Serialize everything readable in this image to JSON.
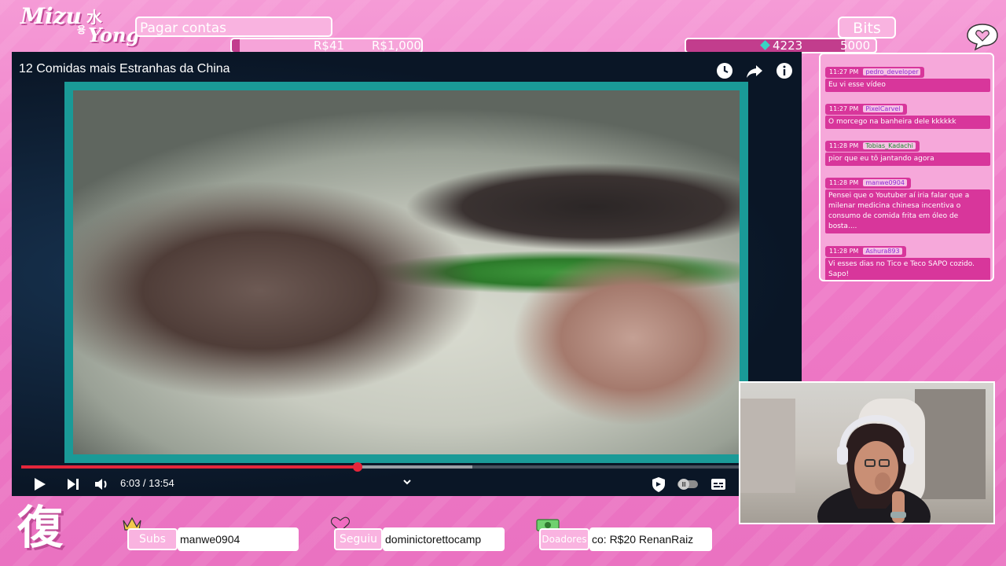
{
  "overlay": {
    "logo": {
      "name": "Mizu",
      "kanji": "水",
      "hangul": "용",
      "name2": "Yong"
    },
    "goal": {
      "title": "Pagar contas",
      "current": "R$41",
      "target": "R$1,000",
      "progress_fraction": 0.04
    },
    "bits": {
      "title": "Bits",
      "current": "4223",
      "target": "5000",
      "progress_fraction": 0.84
    },
    "bottom_kanji": "復",
    "subs": {
      "label": "Subs",
      "value": "manwe0904"
    },
    "follow": {
      "label": "Seguiu",
      "value": "dominictorettocamp"
    },
    "donors": {
      "label": "Doadores",
      "value": "co: R$20    RenanRaiz"
    }
  },
  "video": {
    "title": "12 Comidas mais Estranhas da China",
    "time": "6:03 / 13:54",
    "played_fraction": 0.44,
    "buffered_fraction": 0.59,
    "icons": [
      "clock-icon",
      "share-icon",
      "info-icon"
    ],
    "controls": [
      "play-icon",
      "next-icon",
      "volume-icon",
      "chevron-up-icon",
      "shield-icon",
      "autoplay-toggle",
      "subtitles-icon"
    ]
  },
  "chat": {
    "messages": [
      {
        "time": "11:27 PM",
        "user": "pedro_developer",
        "user_color": "#8e2dd6",
        "text": "Eu vi esse vídeo"
      },
      {
        "time": "11:27 PM",
        "user": "PixelCarvel",
        "user_color": "#8e2dd6",
        "text": "O morcego na banheira dele kkkkkk"
      },
      {
        "time": "11:28 PM",
        "user": "Tobias_Kadachi",
        "user_color": "#1f8a2e",
        "text": "pior que eu tô jantando agora"
      },
      {
        "time": "11:28 PM",
        "user": "manwe0904",
        "user_color": "#8e2dd6",
        "text": "Pensei que o Youtuber aí iria falar que a milenar medicina chinesa incentiva o consumo de comida frita em óleo de bosta...."
      },
      {
        "time": "11:28 PM",
        "user": "Ashura893",
        "user_color": "#8e2dd6",
        "text": "Vi esses dias no Tico e Teco SAPO cozido. Sapo!"
      }
    ]
  },
  "colors": {
    "background": "#f07cc8",
    "accent": "#c23d8d",
    "frame": "#1a9a97",
    "progress": "#e5263b"
  }
}
